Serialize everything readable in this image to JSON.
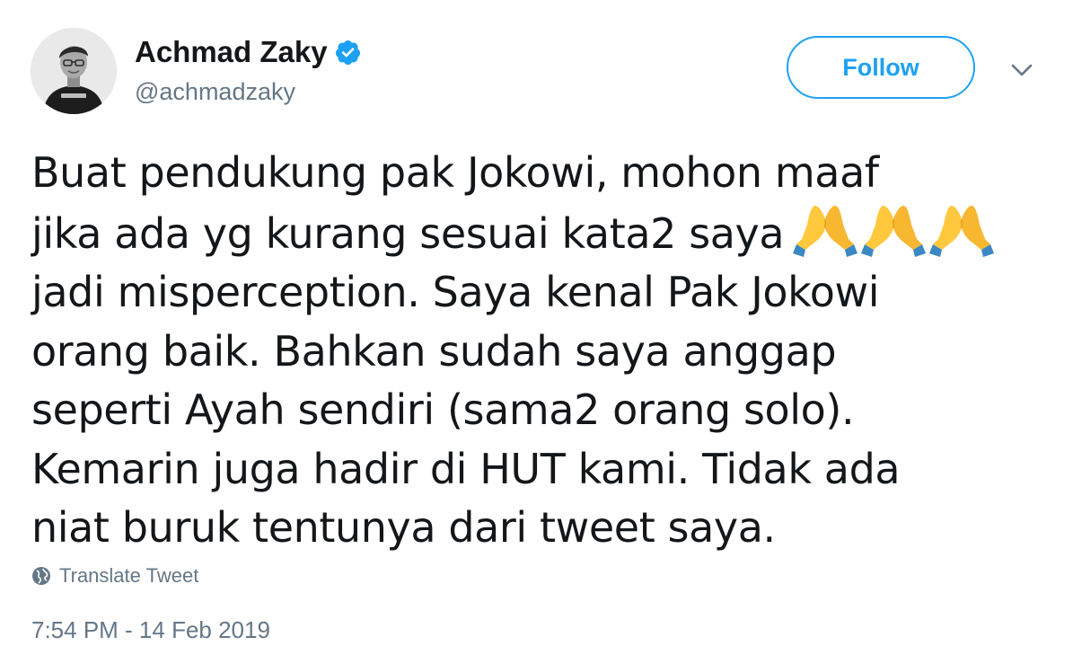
{
  "author": {
    "display_name": "Achmad Zaky",
    "handle": "@achmadzaky",
    "verified": true,
    "avatar_icon": "profile-photo"
  },
  "actions": {
    "follow_label": "Follow",
    "menu_icon": "chevron-down-icon"
  },
  "tweet": {
    "lines": [
      "Buat pendukung pak Jokowi, mohon maaf",
      "jika ada yg kurang sesuai kata2 saya",
      "jadi misperception. Saya kenal Pak Jokowi",
      "orang baik. Bahkan sudah saya anggap",
      "seperti Ayah sendiri (sama2 orang solo).",
      "Kemarin juga hadir di HUT kami. Tidak ada",
      "niat buruk tentunya dari tweet saya."
    ],
    "emoji": [
      "folded-hands",
      "folded-hands",
      "folded-hands"
    ]
  },
  "translate_label": "Translate Tweet",
  "timestamp": "7:54 PM - 14 Feb 2019",
  "colors": {
    "accent": "#1da1f2",
    "text": "#14171a",
    "secondary": "#657786"
  }
}
